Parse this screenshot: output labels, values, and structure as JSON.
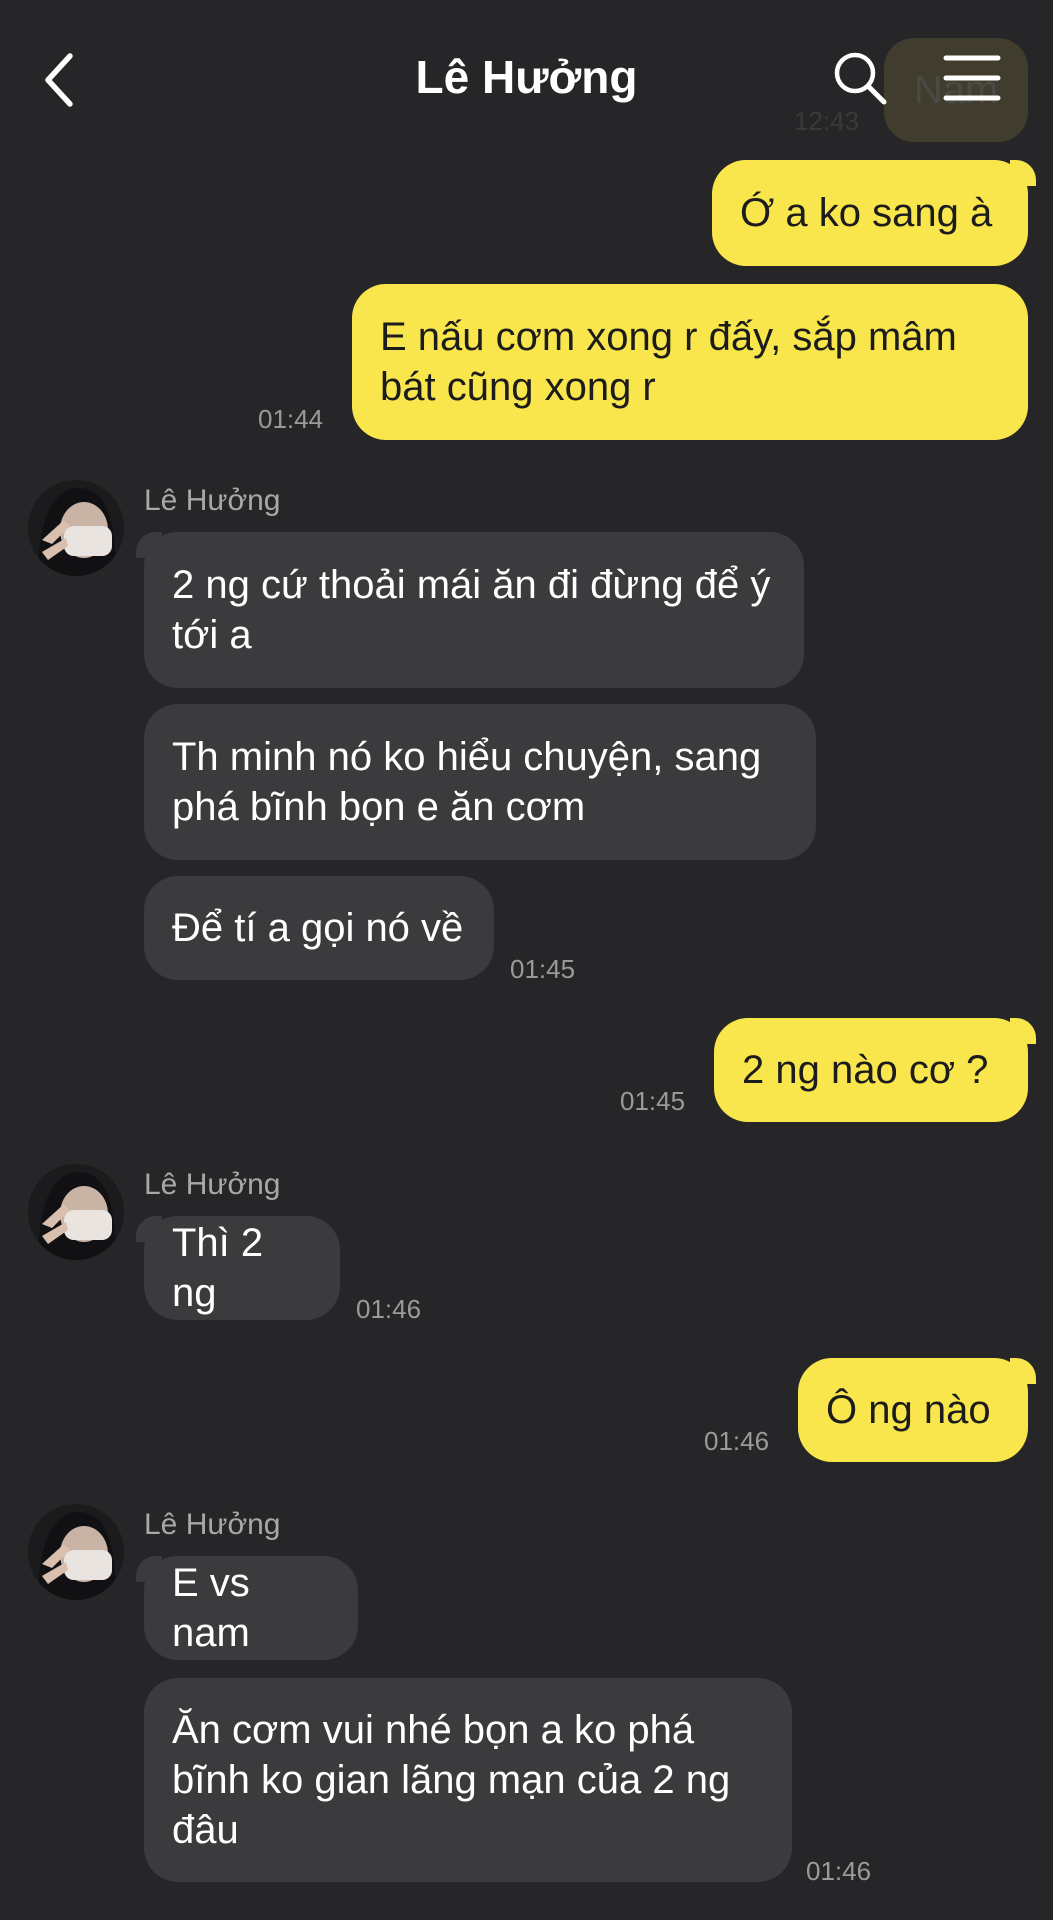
{
  "header": {
    "title": "Lê Hưởng",
    "back_icon": "chevron-left-icon",
    "search_icon": "search-icon",
    "menu_icon": "hamburger-menu-icon"
  },
  "ghost": {
    "text": "Nam",
    "time": "12:43"
  },
  "colors": {
    "background": "#262628",
    "my_bubble": "#f9e64c",
    "their_bubble": "#3b3b3e",
    "timestamp": "#9a9a9a"
  },
  "messages": [
    {
      "from": "me",
      "text": "Ớ a ko sang à",
      "time": ""
    },
    {
      "from": "me",
      "text": "E nấu cơm xong r đấy, sắp mâm bát cũng xong r",
      "time": "01:44"
    },
    {
      "sender": "Lê Hưởng"
    },
    {
      "from": "them",
      "text": "2 ng cứ thoải mái ăn đi đừng để ý tới a",
      "time": ""
    },
    {
      "from": "them",
      "text": "Th minh nó ko hiểu chuyện, sang phá bĩnh bọn e ăn cơm",
      "time": ""
    },
    {
      "from": "them",
      "text": "Để tí a gọi nó về",
      "time": "01:45"
    },
    {
      "from": "me",
      "text": "2 ng nào cơ ?",
      "time": "01:45"
    },
    {
      "sender": "Lê Hưởng"
    },
    {
      "from": "them",
      "text": "Thì 2 ng",
      "time": "01:46"
    },
    {
      "from": "me",
      "text": "Ô ng nào",
      "time": "01:46"
    },
    {
      "sender": "Lê Hưởng"
    },
    {
      "from": "them",
      "text": "E vs nam",
      "time": ""
    },
    {
      "from": "them",
      "text": "Ăn cơm vui nhé bọn a ko phá bĩnh ko gian lãng mạn của 2 ng đâu",
      "time": "01:46"
    }
  ]
}
